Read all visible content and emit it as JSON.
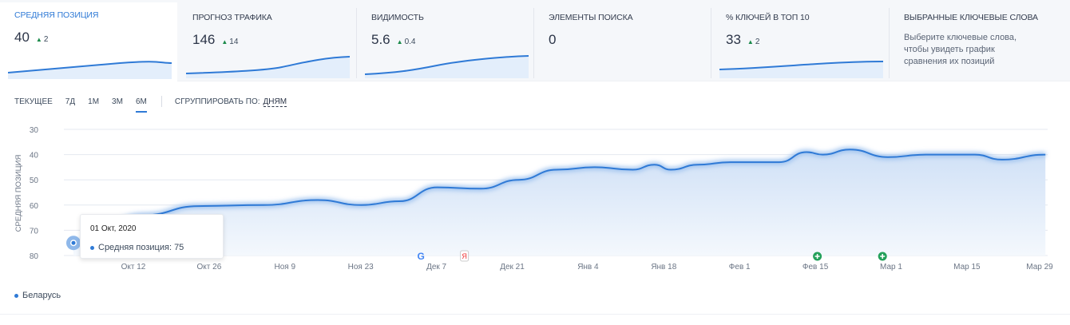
{
  "cards": [
    {
      "title": "Средняя позиция",
      "value": "40",
      "delta": "2",
      "active": true
    },
    {
      "title": "Прогноз трафика",
      "value": "146",
      "delta": "14"
    },
    {
      "title": "Видимость",
      "value": "5.6",
      "delta": "0.4"
    },
    {
      "title": "Элементы поиска",
      "value": "0"
    },
    {
      "title": "% ключей в топ 10",
      "value": "33",
      "delta": "2"
    },
    {
      "title": "Выбранные ключевые слова",
      "description": "Выберите ключевые слова, чтобы увидеть график сравнения их позиций"
    }
  ],
  "toolbar": {
    "periods": [
      "ТЕКУЩЕЕ",
      "7Д",
      "1М",
      "3М",
      "6М"
    ],
    "selected_period": "6М",
    "group_label": "СГРУППИРОВАТЬ ПО:",
    "group_value": "ДНЯМ"
  },
  "tooltip": {
    "date": "01 Окт, 2020",
    "series": "Средняя позиция:",
    "value": "75"
  },
  "legend": {
    "item": "Беларусь"
  },
  "colors": {
    "accent": "#2f7ad6",
    "positive": "#1b8a4a"
  },
  "chart_data": {
    "type": "area",
    "ylabel": "СРЕДНЯЯ ПОЗИЦИЯ",
    "yticks": [
      30,
      40,
      50,
      60,
      70,
      80
    ],
    "ylim": [
      80,
      30
    ],
    "y_inverted": true,
    "grid": true,
    "xticks": [
      "Окт 12",
      "Окт 26",
      "Ноя 9",
      "Ноя 23",
      "Дек 7",
      "Дек 21",
      "Янв 4",
      "Янв 18",
      "Фев 1",
      "Фев 15",
      "Мар 1",
      "Мар 15",
      "Мар 29"
    ],
    "series": [
      {
        "name": "Беларусь",
        "points": [
          [
            "2020-10-01",
            75
          ],
          [
            "2020-10-14",
            64
          ],
          [
            "2020-10-24",
            60.4
          ],
          [
            "2020-11-05",
            60
          ],
          [
            "2020-11-15",
            58
          ],
          [
            "2020-11-23",
            60
          ],
          [
            "2020-11-30",
            58.5
          ],
          [
            "2020-12-07",
            53
          ],
          [
            "2020-12-15",
            53.5
          ],
          [
            "2020-12-22",
            50
          ],
          [
            "2020-12-29",
            46
          ],
          [
            "2021-01-05",
            45
          ],
          [
            "2021-01-12",
            46
          ],
          [
            "2021-01-16",
            44
          ],
          [
            "2021-01-19",
            46
          ],
          [
            "2021-01-24",
            44
          ],
          [
            "2021-01-30",
            43
          ],
          [
            "2021-02-08",
            43
          ],
          [
            "2021-02-13",
            39
          ],
          [
            "2021-02-16",
            40
          ],
          [
            "2021-02-21",
            38
          ],
          [
            "2021-02-28",
            41
          ],
          [
            "2021-03-07",
            40
          ],
          [
            "2021-03-16",
            40
          ],
          [
            "2021-03-21",
            42
          ],
          [
            "2021-03-29",
            40
          ]
        ]
      }
    ],
    "annotations": [
      {
        "date": "2020-12-04",
        "icon": "google-icon"
      },
      {
        "date": "2020-12-12",
        "icon": "yandex-icon"
      },
      {
        "date": "2021-02-15",
        "icon": "plus-event-icon"
      },
      {
        "date": "2021-02-27",
        "icon": "plus-event-icon"
      }
    ]
  }
}
